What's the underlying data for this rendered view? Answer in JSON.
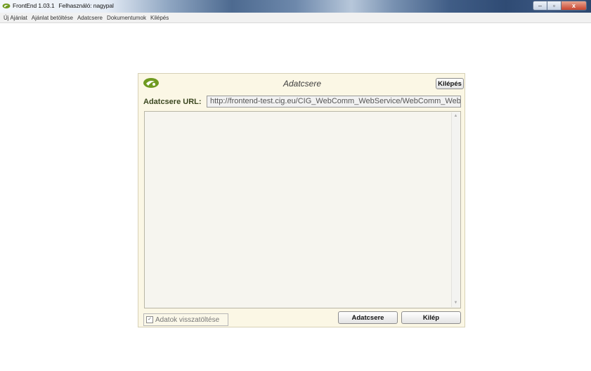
{
  "window": {
    "app_name": "FrontEnd 1.03.1",
    "user_label": "Felhasználó: nagypal",
    "minimize_glyph": "–",
    "maximize_glyph": "▫",
    "close_glyph": "x"
  },
  "menu": {
    "items": [
      {
        "label": "Új Ajánlat"
      },
      {
        "label": "Ajánlat betöltése"
      },
      {
        "label": "Adatcsere"
      },
      {
        "label": "Dokumentumok"
      },
      {
        "label": "Kilépés"
      }
    ]
  },
  "dialog": {
    "title": "Adatcsere",
    "exit_button": "Kilépés",
    "url_label": "Adatcsere URL:",
    "url_value": "http://frontend-test.cig.eu/CIG_WebComm_WebService/WebComm_Web...",
    "log_text": "",
    "checkbox_label": "Adatok visszatöltése",
    "checkbox_checked": true,
    "exchange_button": "Adatcsere",
    "close_button": "Kilép"
  },
  "icons": {
    "app": "app-logo-icon",
    "dialog_logo": "cig-logo-icon",
    "scroll_up": "scroll-up-icon",
    "scroll_down": "scroll-down-icon"
  },
  "colors": {
    "dialog_bg": "#fbf7e5",
    "label_green": "#3b4720",
    "logo_green": "#6f9a21"
  }
}
